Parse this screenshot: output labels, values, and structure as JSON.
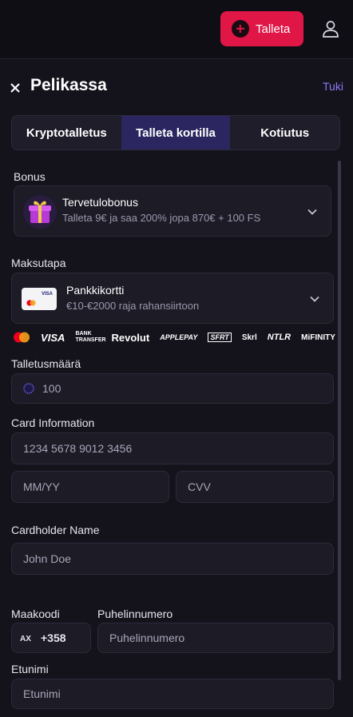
{
  "header": {
    "deposit_label": "Talleta"
  },
  "panel": {
    "title": "Pelikassa",
    "help_label": "Tuki",
    "tabs": [
      {
        "label": "Kryptotalletus"
      },
      {
        "label": "Talleta kortilla",
        "active": true
      },
      {
        "label": "Kotiutus"
      }
    ]
  },
  "bonus": {
    "label": "Bonus",
    "name": "Tervetulobonus",
    "description": "Talleta 9€ ja saa 200% jopa 870€ + 100 FS"
  },
  "payment": {
    "label": "Maksutapa",
    "card_brand": "VISA",
    "method_name": "Pankkikortti",
    "method_range": "€10-€2000 raja rahansiirtoon",
    "logos": [
      "VISA",
      "BANK TRANSFER",
      "Revolut",
      "APPLEPAY",
      "SFRT",
      "Skrl",
      "NTLR",
      "MiFINITY"
    ]
  },
  "amount": {
    "label": "Talletusmäärä",
    "value": "100"
  },
  "card": {
    "label": "Card Information",
    "number_placeholder": "1234 5678 9012 3456",
    "expiry_placeholder": "MM/YY",
    "cvv_placeholder": "CVV",
    "holder_label": "Cardholder Name",
    "holder_placeholder": "John Doe"
  },
  "phone": {
    "country_label": "Maakoodi",
    "country_iso": "AX",
    "country_code": "+358",
    "number_label": "Puhelinnumero",
    "number_placeholder": "Puhelinnumero"
  },
  "firstname": {
    "label": "Etunimi",
    "placeholder": "Etunimi"
  },
  "colors": {
    "accent": "#e01646",
    "active_tab": "#2b2660",
    "link": "#8b7cf6"
  }
}
